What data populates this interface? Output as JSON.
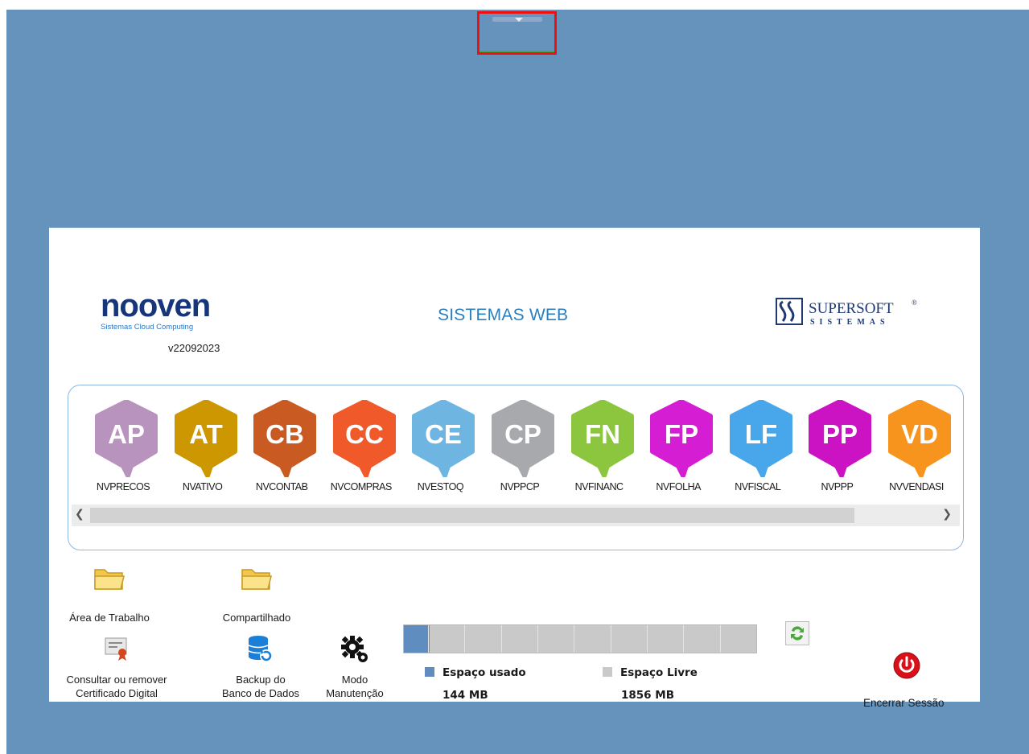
{
  "header": {
    "brand": "nooven",
    "brand_tagline": "Sistemas Cloud Computing",
    "version": "v22092023",
    "title": "SISTEMAS WEB",
    "partner_logo_top": "SUPERSOFT",
    "partner_logo_bottom": "SISTEMAS",
    "partner_logo_mark": "®"
  },
  "apps": [
    {
      "code": "AP",
      "label": "NVPRECOS",
      "color": "#b893bd"
    },
    {
      "code": "AT",
      "label": "NVATIVO",
      "color": "#cc9700"
    },
    {
      "code": "CB",
      "label": "NVCONTAB",
      "color": "#c95a21"
    },
    {
      "code": "CC",
      "label": "NVCOMPRAS",
      "color": "#f05a2a"
    },
    {
      "code": "CE",
      "label": "NVESTOQ",
      "color": "#6fb5e2"
    },
    {
      "code": "CP",
      "label": "NVPPCP",
      "color": "#a7a9ac"
    },
    {
      "code": "FN",
      "label": "NVFINANC",
      "color": "#8cc63f"
    },
    {
      "code": "FP",
      "label": "NVFOLHA",
      "color": "#d51ed4"
    },
    {
      "code": "LF",
      "label": "NVFISCAL",
      "color": "#48a6ea"
    },
    {
      "code": "PP",
      "label": "NVPPP",
      "color": "#cc13c4"
    },
    {
      "code": "VD",
      "label": "NVVENDASI",
      "color": "#f7941d"
    }
  ],
  "tools": {
    "workspace": "Área de Trabalho",
    "shared": "Compartilhado",
    "certificate_line1": "Consultar ou remover",
    "certificate_line2": "Certificado Digital",
    "backup_line1": "Backup do",
    "backup_line2": "Banco de Dados",
    "maintenance_line1": "Modo",
    "maintenance_line2": "Manutenção"
  },
  "storage": {
    "used_label": "Espaço usado",
    "used_value": "144 MB",
    "free_label": "Espaço Livre",
    "free_value": "1856 MB",
    "used_fraction": 0.072,
    "used_color": "#5f8dc0",
    "free_color": "#c9c9c9"
  },
  "session": {
    "logout_label": "Encerrar Sessão",
    "logout_color": "#d9101a"
  },
  "icons": {
    "tab_handle": "chevron-down-icon",
    "folder": "folder-icon",
    "certificate": "certificate-icon",
    "database": "database-backup-icon",
    "gear": "gear-icon",
    "refresh": "refresh-icon",
    "power": "power-icon"
  }
}
